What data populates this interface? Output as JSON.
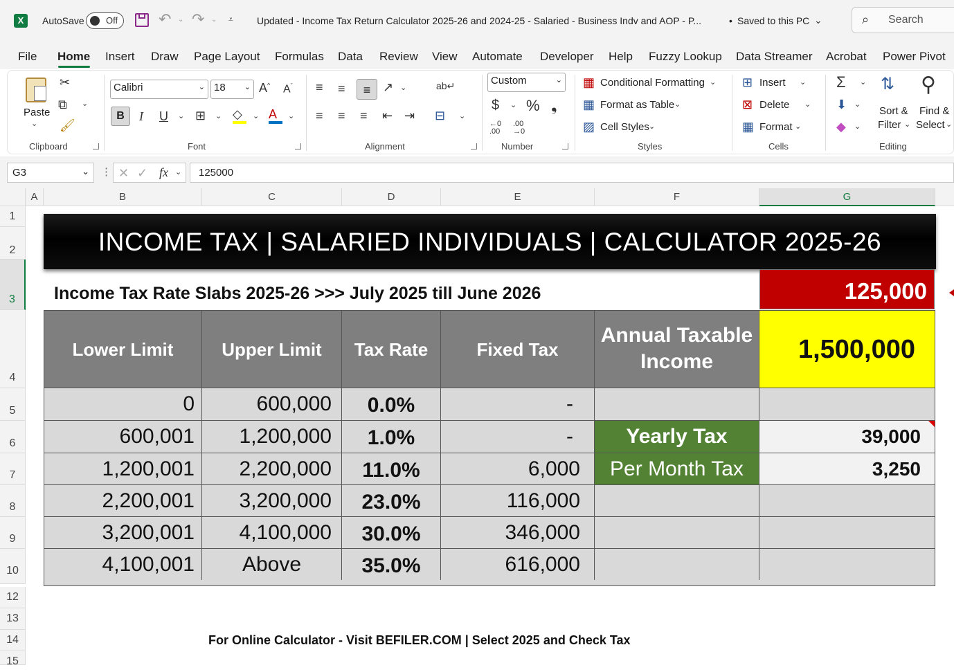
{
  "titlebar": {
    "autosave_label": "AutoSave",
    "autosave_state": "Off",
    "doc_title": "Updated - Income Tax Return Calculator 2025-26 and 2024-25 - Salaried - Business Indv and AOP - P...",
    "save_status": "Saved to this PC",
    "search_placeholder": "Search"
  },
  "menu": [
    "File",
    "Home",
    "Insert",
    "Draw",
    "Page Layout",
    "Formulas",
    "Data",
    "Review",
    "View",
    "Automate",
    "Developer",
    "Help",
    "Fuzzy Lookup",
    "Data Streamer",
    "Acrobat",
    "Power Pivot"
  ],
  "ribbon": {
    "clipboard": {
      "paste": "Paste",
      "group": "Clipboard"
    },
    "font": {
      "name": "Calibri",
      "size": "18",
      "group": "Font"
    },
    "alignment": {
      "group": "Alignment"
    },
    "number": {
      "format": "Custom",
      "group": "Number"
    },
    "styles": {
      "conditional": "Conditional Formatting",
      "table": "Format as Table",
      "cell_styles": "Cell Styles",
      "group": "Styles"
    },
    "cells": {
      "insert": "Insert",
      "delete": "Delete",
      "format": "Format",
      "group": "Cells"
    },
    "editing": {
      "sort1": "Sort &",
      "sort2": "Filter",
      "find1": "Find &",
      "find2": "Select",
      "group": "Editing"
    }
  },
  "formula_bar": {
    "name_box": "G3",
    "value": "125000"
  },
  "columns": [
    "A",
    "B",
    "C",
    "D",
    "E",
    "F",
    "G"
  ],
  "rows": [
    "1",
    "2",
    "3",
    "4",
    "5",
    "6",
    "7",
    "8",
    "9",
    "10",
    "12",
    "13",
    "14",
    "15"
  ],
  "sheet": {
    "banner": "INCOME TAX | SALARIED INDIVIDUALS | CALCULATOR 2025-26",
    "subtitle": "Income Tax Rate Slabs 2025-26 >>> July 2025 till June 2026",
    "monthly_salary": "125,000",
    "headers": [
      "Lower Limit",
      "Upper Limit",
      "Tax Rate",
      "Fixed Tax"
    ],
    "annual_label": "Annual Taxable Income",
    "annual_value": "1,500,000",
    "slabs": [
      {
        "lower": "0",
        "upper": "600,000",
        "rate": "0.0%",
        "fixed": "-"
      },
      {
        "lower": "600,001",
        "upper": "1,200,000",
        "rate": "1.0%",
        "fixed": "-"
      },
      {
        "lower": "1,200,001",
        "upper": "2,200,000",
        "rate": "11.0%",
        "fixed": "6,000"
      },
      {
        "lower": "2,200,001",
        "upper": "3,200,000",
        "rate": "23.0%",
        "fixed": "116,000"
      },
      {
        "lower": "3,200,001",
        "upper": "4,100,000",
        "rate": "30.0%",
        "fixed": "346,000"
      },
      {
        "lower": "4,100,001",
        "upper": "Above",
        "rate": "35.0%",
        "fixed": "616,000"
      }
    ],
    "yearly_label": "Yearly Tax",
    "yearly_value": "39,000",
    "monthly_label": "Per Month Tax",
    "monthly_value": "3,250",
    "footer": "For Online Calculator - Visit BEFILER.COM | Select 2025 and Check Tax"
  },
  "colors": {
    "excel_green": "#107c41",
    "red": "#c00000",
    "yellow": "#ffff00",
    "table_green": "#548235",
    "header_gray": "#7f7f7f"
  }
}
